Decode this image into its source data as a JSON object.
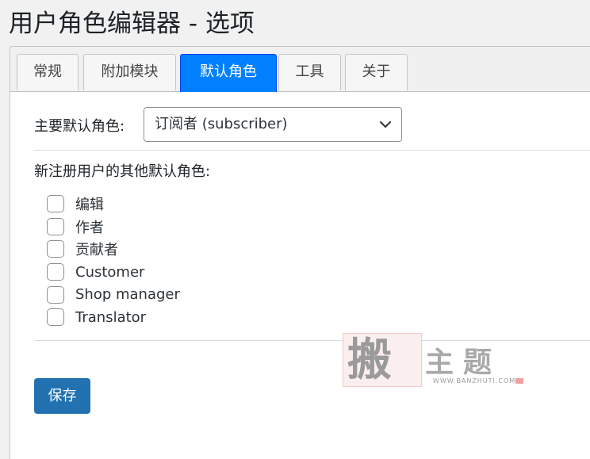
{
  "page": {
    "title": "用户角色编辑器 - 选项"
  },
  "tabs": [
    {
      "label": "常规",
      "active": false
    },
    {
      "label": "附加模块",
      "active": false
    },
    {
      "label": "默认角色",
      "active": true
    },
    {
      "label": "工具",
      "active": false
    },
    {
      "label": "关于",
      "active": false
    }
  ],
  "primary_role": {
    "label": "主要默认角色:",
    "selected": "订阅者 (subscriber)"
  },
  "other_roles": {
    "heading": "新注册用户的其他默认角色:",
    "items": [
      {
        "label": "编辑",
        "checked": false
      },
      {
        "label": "作者",
        "checked": false
      },
      {
        "label": "贡献者",
        "checked": false
      },
      {
        "label": "Customer",
        "checked": false
      },
      {
        "label": "Shop manager",
        "checked": false
      },
      {
        "label": "Translator",
        "checked": false
      }
    ]
  },
  "actions": {
    "save_label": "保存"
  },
  "watermark": {
    "seal_char": "搬",
    "title": "主题",
    "url": "WWW.BANZHUTI.COM"
  },
  "colors": {
    "active_tab": "#007fff",
    "save_button": "#2271b1"
  },
  "icons": {
    "select": "chevron-down-icon"
  }
}
